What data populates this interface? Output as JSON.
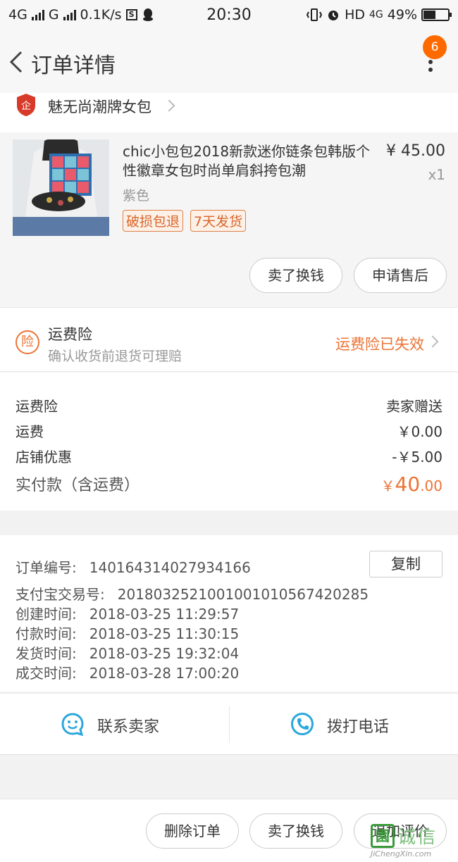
{
  "status_bar": {
    "network_left": "4G",
    "network_mid": "G",
    "speed": "0.1K/s",
    "s_icon_letter": "S",
    "time": "20:30",
    "hd_label": "HD",
    "network_right": "4G",
    "battery_percent": "49%",
    "battery_level": 0.49
  },
  "nav": {
    "title": "订单详情",
    "notification_count": "6"
  },
  "shop": {
    "name": "魅无尚潮牌女包",
    "logo_glyph": "企",
    "logo_color": "#d83a2a"
  },
  "item": {
    "title": "chic小包包2018新款迷你链条包韩版个性徽章女包时尚单肩斜挎包潮",
    "price": "¥ 45.00",
    "quantity": "x1",
    "sku": "紫色",
    "tags": [
      "破损包退",
      "7天发货"
    ],
    "buttons": {
      "sell": "卖了换钱",
      "after_sale": "申请售后"
    }
  },
  "insurance": {
    "icon_glyph": "险",
    "title": "运费险",
    "subtitle": "确认收货前退货可理赔",
    "status": "运费险已失效"
  },
  "fees": {
    "rows": [
      {
        "label": "运费险",
        "value": "卖家赠送"
      },
      {
        "label": "运费",
        "value": "￥0.00"
      },
      {
        "label": "店铺优惠",
        "value": "-￥5.00"
      }
    ],
    "paid": {
      "label": "实付款（含运费）",
      "currency": "￥",
      "integer": "40",
      "decimal": ".00"
    }
  },
  "order_info": {
    "copy_button": "复制",
    "rows": [
      {
        "label": "订单编号:",
        "value": "140164314027934166"
      },
      {
        "label": "支付宝交易号:",
        "value": "2018032521001001010567420285"
      },
      {
        "label": "创建时间:",
        "value": "2018-03-25 11:29:57"
      },
      {
        "label": "付款时间:",
        "value": "2018-03-25 11:30:15"
      },
      {
        "label": "发货时间:",
        "value": "2018-03-25 19:32:04"
      },
      {
        "label": "成交时间:",
        "value": "2018-03-28 17:00:20"
      }
    ]
  },
  "contact": {
    "seller": "联系卖家",
    "call": "拨打电话",
    "icon_color": "#2aa7dc"
  },
  "bottom_actions": {
    "delete": "删除订单",
    "sell": "卖了换钱",
    "review": "追加评价"
  },
  "watermark": {
    "glyph": "園",
    "text": "诚信",
    "url": "JiChengXin.com"
  },
  "accent_color": "#ec7335"
}
